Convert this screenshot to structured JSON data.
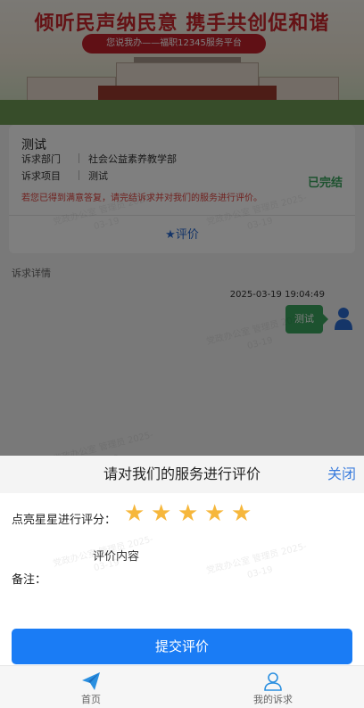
{
  "banner": {
    "title": "倾听民声纳民意 携手共创促和谐",
    "subtitle": "您说我办——福职12345服务平台"
  },
  "case_card": {
    "title": "测试",
    "department_label": "诉求部门",
    "department_value": "社会公益素养教学部",
    "item_label": "诉求项目",
    "item_value": "测试",
    "status": "已完结",
    "hint": "若您已得到满意答复，请完结诉求并对我们的服务进行评价。",
    "evaluate_label": "评价"
  },
  "detail": {
    "section_label": "诉求详情",
    "message_time": "2025-03-19 19:04:49",
    "message_text": "测试"
  },
  "watermark": "党政办公室 管理员 2025-\n03-19",
  "sheet": {
    "title": "请对我们的服务进行评价",
    "close_label": "关闭",
    "rating_label": "点亮星星进行评分：",
    "rating_value": 5,
    "rating_max": 5,
    "remark_label": "备注：",
    "remark_placeholder": "评价内容",
    "submit_label": "提交评价"
  },
  "tabbar": {
    "items": [
      {
        "label": "首页",
        "icon": "paper-plane-icon"
      },
      {
        "label": "我的诉求",
        "icon": "user-icon"
      }
    ]
  },
  "colors": {
    "accent": "#1a7cf5",
    "star": "#f6b73c",
    "status_green": "#3aa55e",
    "hint_red": "#e0433e"
  }
}
